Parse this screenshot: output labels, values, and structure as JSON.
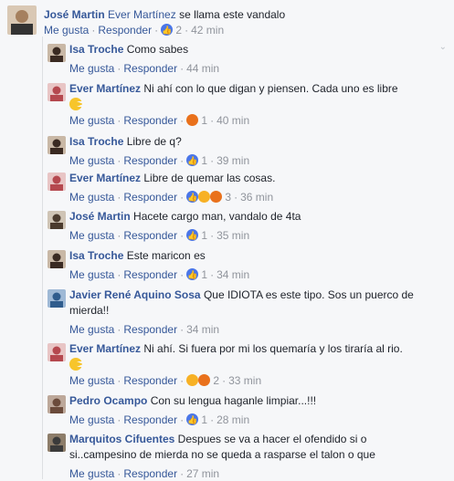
{
  "top": {
    "name": "José Martin",
    "mention": "Ever Martínez",
    "text": " se llama este vandalo",
    "like": "Me gusta",
    "reply": "Responder",
    "count": "2",
    "time": "42 min"
  },
  "replies": [
    {
      "name": "Isa Troche",
      "text": "Como sabes",
      "like": "Me gusta",
      "reply": "Responder",
      "count": "",
      "time": "44 min",
      "reaction": "none"
    },
    {
      "name": "Ever Martínez",
      "text": "Ni ahí con lo que digan y piensen. Cada uno es libre",
      "like": "Me gusta",
      "reply": "Responder",
      "count": "1",
      "time": "40 min",
      "reaction": "angry-icon"
    },
    {
      "name": "Isa Troche",
      "text": "Libre de q?",
      "like": "Me gusta",
      "reply": "Responder",
      "count": "1",
      "time": "39 min",
      "reaction": "like-icon"
    },
    {
      "name": "Ever Martínez",
      "text": "Libre de quemar las cosas.",
      "like": "Me gusta",
      "reply": "Responder",
      "count": "3",
      "time": "36 min",
      "reaction": "multi"
    },
    {
      "name": "José Martin",
      "text": "Hacete cargo man, vandalo de 4ta",
      "like": "Me gusta",
      "reply": "Responder",
      "count": "1",
      "time": "35 min",
      "reaction": "like-icon"
    },
    {
      "name": "Isa Troche",
      "text": "Este maricon es",
      "like": "Me gusta",
      "reply": "Responder",
      "count": "1",
      "time": "34 min",
      "reaction": "like-icon"
    },
    {
      "name": "Javier René Aquino Sosa",
      "text": "Que IDIOTA es este tipo. Sos un puerco de",
      "text2": "mierda!!",
      "like": "Me gusta",
      "reply": "Responder",
      "count": "",
      "time": "34 min",
      "reaction": "none"
    },
    {
      "name": "Ever Martínez",
      "text": "Ni ahí. Si fuera por mi los quemaría y los tiraría al rio.",
      "like": "Me gusta",
      "reply": "Responder",
      "count": "2",
      "time": "33 min",
      "reaction": "haha-angry"
    },
    {
      "name": "Pedro Ocampo",
      "text": "Con su lengua haganle limpiar...!!!",
      "like": "Me gusta",
      "reply": "Responder",
      "count": "1",
      "time": "28 min",
      "reaction": "like-icon"
    },
    {
      "name": "Marquitos Cifuentes",
      "text": "Despues se va a hacer el ofendido si o",
      "text2": "si..campesino de mierda no se queda a rasparse el talon o que",
      "like": "Me gusta",
      "reply": "Responder",
      "count": "",
      "time": "27 min",
      "reaction": "none"
    }
  ]
}
